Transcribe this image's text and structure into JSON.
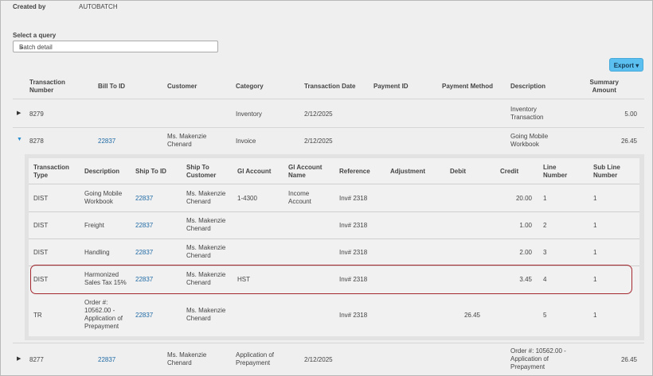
{
  "created_by": {
    "label": "Created by",
    "value": "AUTOBATCH"
  },
  "query": {
    "label": "Select a query",
    "selected": "Batch detail"
  },
  "export_label": "Export ▾",
  "main_headers": {
    "txn_number": [
      "Transaction",
      "Number"
    ],
    "bill_to": "Bill To ID",
    "customer": "Customer",
    "category": "Category",
    "txn_date": "Transaction Date",
    "payment_id": "Payment ID",
    "payment_method": "Payment Method",
    "description": "Description",
    "summary_amount": [
      "Summary",
      "Amount"
    ]
  },
  "rows": [
    {
      "number": "8279",
      "bill_to": "",
      "customer": [],
      "category": [
        "Inventory"
      ],
      "date": "2/12/2025",
      "description": [
        "Inventory",
        "Transaction"
      ],
      "amount": "5.00",
      "expanded": false
    },
    {
      "number": "8278",
      "bill_to": "22837",
      "customer": [
        "Ms. Makenzie",
        "Chenard"
      ],
      "category": [
        "Invoice"
      ],
      "date": "2/12/2025",
      "description": [
        "Going Mobile",
        "Workbook"
      ],
      "amount": "26.45",
      "expanded": true
    },
    {
      "number": "8277",
      "bill_to": "22837",
      "customer": [
        "Ms. Makenzie",
        "Chenard"
      ],
      "category": [
        "Application of",
        "Prepayment"
      ],
      "date": "2/12/2025",
      "description": [
        "Order #: 10562.00 -",
        "Application of",
        "Prepayment"
      ],
      "amount": "26.45",
      "expanded": false
    }
  ],
  "sub_headers": {
    "type": [
      "Transaction",
      "Type"
    ],
    "description": "Description",
    "ship_to_id": "Ship To ID",
    "ship_to_customer": [
      "Ship To",
      "Customer"
    ],
    "gl_account": "Gl Account",
    "gl_account_name": [
      "Gl Account",
      "Name"
    ],
    "reference": "Reference",
    "adjustment": "Adjustment",
    "debit": "Debit",
    "credit": "Credit",
    "line_number": [
      "Line",
      "Number"
    ],
    "sub_line_number": [
      "Sub Line",
      "Number"
    ]
  },
  "sub_rows": [
    {
      "type": "DIST",
      "description": [
        "Going Mobile",
        "Workbook"
      ],
      "ship_to_id": "22837",
      "ship_to_customer": [
        "Ms. Makenzie",
        "Chenard"
      ],
      "gl_account": "1-4300",
      "gl_account_name": [
        "Income",
        "Account"
      ],
      "reference": "Inv# 2318",
      "adjustment": "",
      "debit": "",
      "credit": "20.00",
      "line": "1",
      "sub_line": "1"
    },
    {
      "type": "DIST",
      "description": [
        "Freight"
      ],
      "ship_to_id": "22837",
      "ship_to_customer": [
        "Ms. Makenzie",
        "Chenard"
      ],
      "gl_account": "",
      "gl_account_name": [],
      "reference": "Inv# 2318",
      "adjustment": "",
      "debit": "",
      "credit": "1.00",
      "line": "2",
      "sub_line": "1"
    },
    {
      "type": "DIST",
      "description": [
        "Handling"
      ],
      "ship_to_id": "22837",
      "ship_to_customer": [
        "Ms. Makenzie",
        "Chenard"
      ],
      "gl_account": "",
      "gl_account_name": [],
      "reference": "Inv# 2318",
      "adjustment": "",
      "debit": "",
      "credit": "2.00",
      "line": "3",
      "sub_line": "1"
    },
    {
      "type": "DIST",
      "description": [
        "Harmonized",
        "Sales Tax 15%"
      ],
      "ship_to_id": "22837",
      "ship_to_customer": [
        "Ms. Makenzie",
        "Chenard"
      ],
      "gl_account": "HST",
      "gl_account_name": [],
      "reference": "Inv# 2318",
      "adjustment": "",
      "debit": "",
      "credit": "3.45",
      "line": "4",
      "sub_line": "1"
    },
    {
      "type": "TR",
      "description": [
        "Order #:",
        "10562.00 -",
        "Application of",
        "Prepayment"
      ],
      "ship_to_id": "22837",
      "ship_to_customer": [
        "Ms. Makenzie",
        "Chenard"
      ],
      "gl_account": "",
      "gl_account_name": [],
      "reference": "Inv# 2318",
      "adjustment": "",
      "debit": "26.45",
      "credit": "",
      "line": "5",
      "sub_line": "1"
    }
  ],
  "colors": {
    "accent": "#5bc0ef",
    "link": "#1f6aa5",
    "highlight": "#a3282f"
  }
}
